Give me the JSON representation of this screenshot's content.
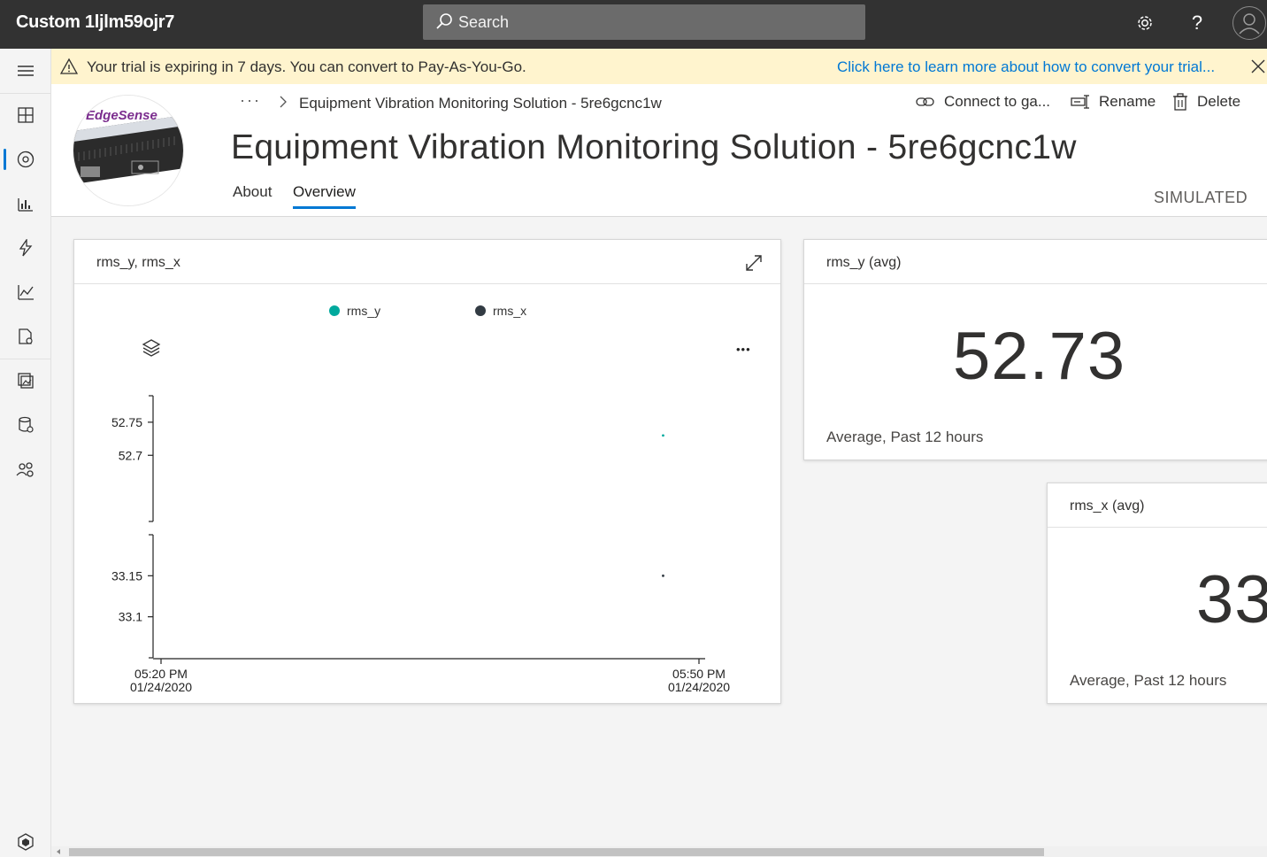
{
  "app": {
    "title": "Custom 1ljlm59ojr7"
  },
  "search": {
    "placeholder": "Search"
  },
  "top_icons": [
    "gear-icon",
    "help-icon",
    "avatar-icon"
  ],
  "help_label": "?",
  "sidebar": {
    "items": [
      {
        "icon": "menu-icon"
      },
      {
        "icon": "dashboard-icon"
      },
      {
        "icon": "devices-icon",
        "active": true
      },
      {
        "icon": "device-groups-icon"
      },
      {
        "icon": "rules-icon"
      },
      {
        "icon": "analytics-icon"
      },
      {
        "icon": "jobs-icon"
      },
      {
        "icon": "device-templates-icon"
      },
      {
        "icon": "data-export-icon"
      },
      {
        "icon": "administration-icon"
      },
      {
        "icon": "app-logo-icon"
      }
    ]
  },
  "banner": {
    "text": "Your trial is expiring in 7 days. You can convert to Pay-As-You-Go.",
    "link": "Click here to learn more about how to convert your trial..."
  },
  "header": {
    "breadcrumb_more": "···",
    "breadcrumb": "Equipment Vibration Monitoring Solution - 5re6gcnc1w",
    "title": "Equipment Vibration Monitoring Solution - 5re6gcnc1w",
    "image_label": "EdgeSense",
    "tabs": [
      {
        "label": "About",
        "active": false
      },
      {
        "label": "Overview",
        "active": true
      }
    ],
    "actions": {
      "connect": "Connect to ga...",
      "rename": "Rename",
      "delete": "Delete"
    },
    "status": "SIMULATED"
  },
  "tiles": {
    "chart": {
      "title": "rms_y, rms_x",
      "more": "•••"
    },
    "kpi_y": {
      "title": "rms_y (avg)",
      "value": "52.73",
      "caption": "Average, Past 12 hours"
    },
    "kpi_x": {
      "title": "rms_x (avg)",
      "value": "33",
      "caption": "Average, Past 12 hours"
    }
  },
  "colors": {
    "accent": "#0078d4",
    "rms_y": "#00a99d",
    "rms_x": "#323b43",
    "banner": "#fff4ce"
  },
  "chart_data": {
    "type": "scatter",
    "title": "rms_y, rms_x",
    "legend": "top",
    "series": [
      {
        "name": "rms_y",
        "x": [
          "05:48 PM"
        ],
        "y": [
          52.73
        ],
        "ylim": [
          52.6,
          52.79
        ],
        "yticks": [
          52.75,
          52.7
        ]
      },
      {
        "name": "rms_x",
        "x": [
          "05:48 PM"
        ],
        "y": [
          33.15
        ],
        "ylim": [
          33.05,
          33.2
        ],
        "yticks": [
          33.15,
          33.1
        ]
      }
    ],
    "x_ticks": [
      {
        "time": "05:20 PM",
        "date": "01/24/2020"
      },
      {
        "time": "05:50 PM",
        "date": "01/24/2020"
      }
    ],
    "grid": false
  }
}
